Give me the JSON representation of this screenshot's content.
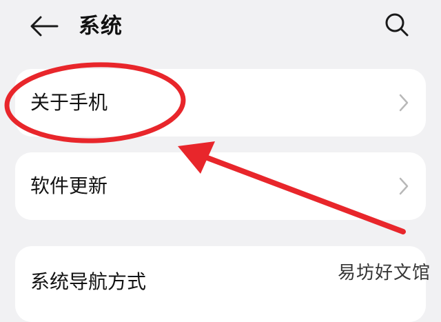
{
  "header": {
    "title": "系统",
    "back_icon": "arrow-left-icon",
    "search_icon": "search-icon"
  },
  "items": [
    {
      "label": "关于手机",
      "icon": "chevron-right-icon"
    },
    {
      "label": "软件更新",
      "icon": "chevron-right-icon"
    },
    {
      "label": "系统导航方式"
    }
  ],
  "watermark": "易坊好文馆",
  "colors": {
    "background": "#f1f1f3",
    "card": "#ffffff",
    "annotation": "#e8262b",
    "chevron": "#b8b8b8"
  }
}
